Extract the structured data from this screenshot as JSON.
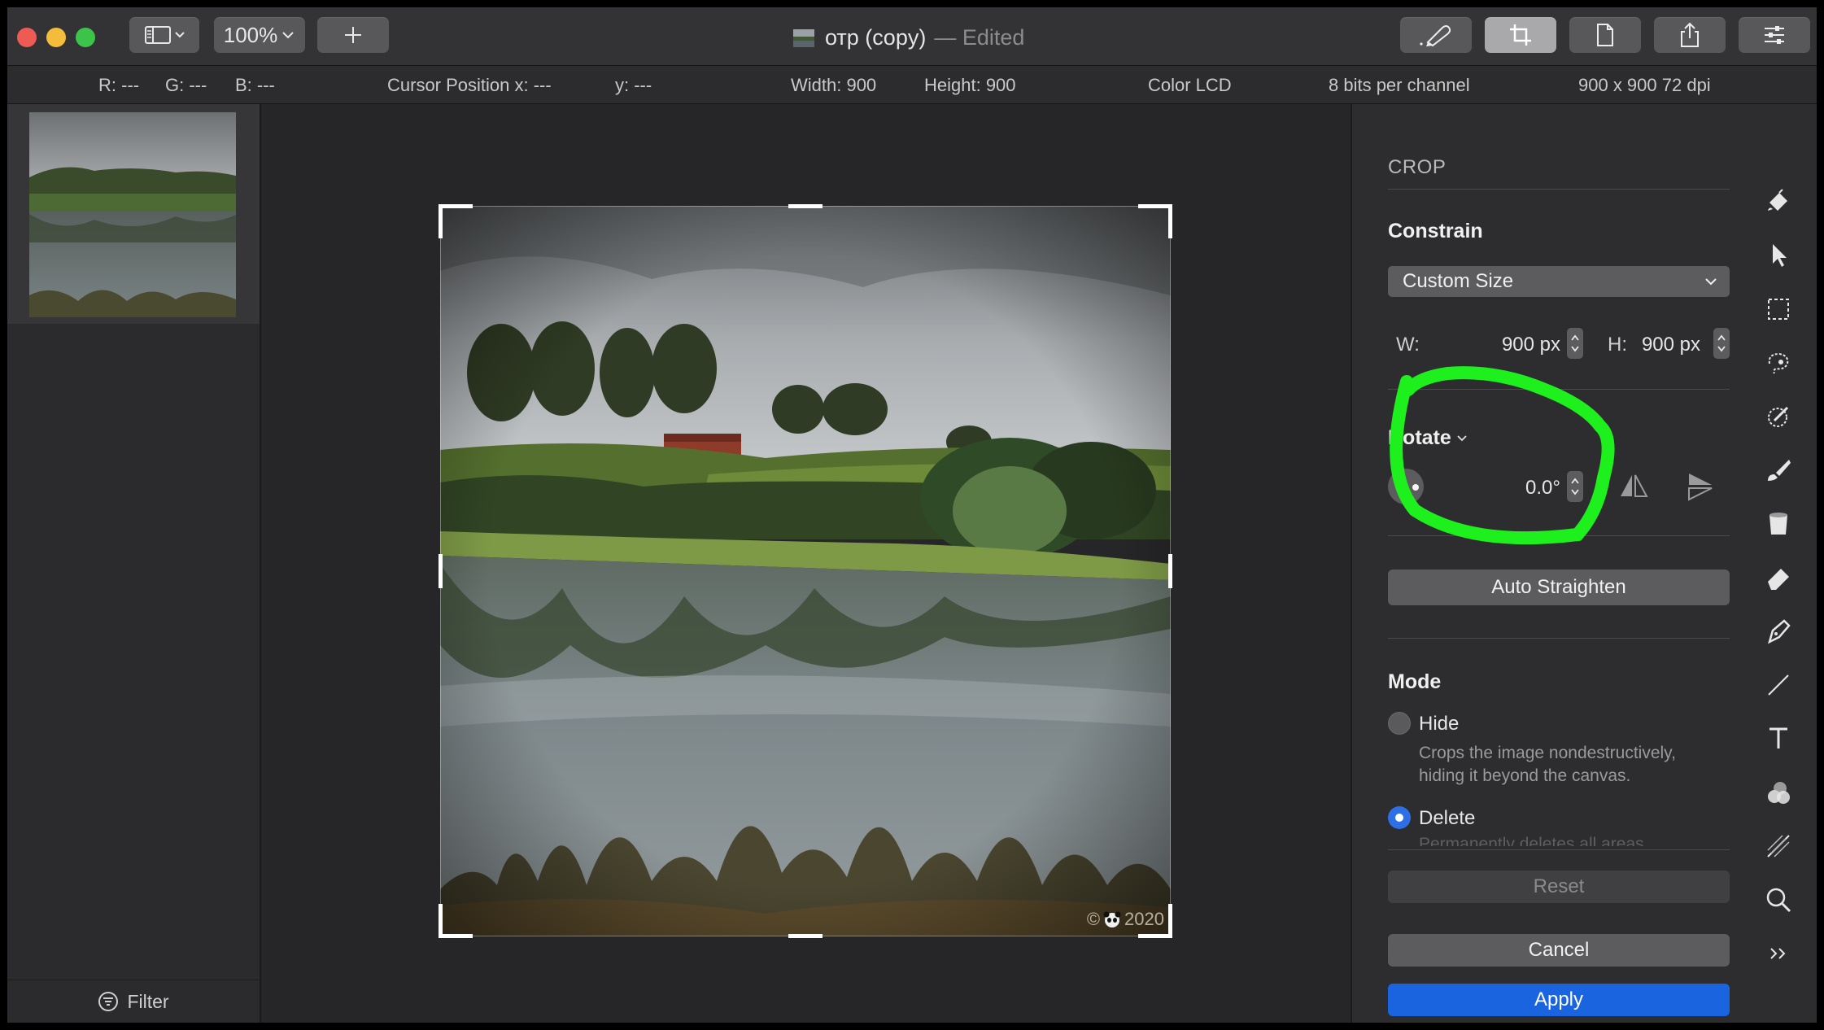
{
  "window": {
    "title": "отр (copy)",
    "title_suffix": "— Edited",
    "zoom": "100%"
  },
  "info": {
    "r": "R: ---",
    "g": "G: ---",
    "b": "B: ---",
    "cursor_x": "Cursor Position x: ---",
    "cursor_y": "y: ---",
    "width": "Width: 900",
    "height": "Height: 900",
    "profile": "Color LCD",
    "depth": "8 bits per channel",
    "resolution": "900 x 900 72 dpi"
  },
  "sidebar": {
    "filter_label": "Filter"
  },
  "image": {
    "watermark": "2020"
  },
  "crop": {
    "section_title": "CROP",
    "constrain_label": "Constrain",
    "constrain_value": "Custom Size",
    "w_label": "W:",
    "w_value": "900 px",
    "h_label": "H:",
    "h_value": "900 px",
    "rotate_label": "Rotate",
    "rotate_value": "0.0°",
    "auto_straighten": "Auto Straighten",
    "mode_label": "Mode",
    "mode_hide": "Hide",
    "mode_hide_desc_1": "Crops the image nondestructively,",
    "mode_hide_desc_2": "hiding it beyond the canvas.",
    "mode_delete": "Delete",
    "mode_delete_desc": "Permanently deletes all areas",
    "reset": "Reset",
    "cancel": "Cancel",
    "apply": "Apply"
  },
  "colors": {
    "accent": "#1a64e0",
    "annotation": "#1ef01e",
    "close": "#ee5b55",
    "minimize": "#f3bd3b",
    "maximize": "#3cc34a"
  },
  "tools": [
    "paint-bucket-icon",
    "arrow-icon",
    "marquee-icon",
    "lasso-icon",
    "magic-wand-icon",
    "brush-icon",
    "bucket-icon",
    "eraser-icon",
    "pen-icon",
    "line-icon",
    "text-icon",
    "shapes-icon",
    "retouch-icon",
    "zoom-icon",
    "more-icon"
  ]
}
